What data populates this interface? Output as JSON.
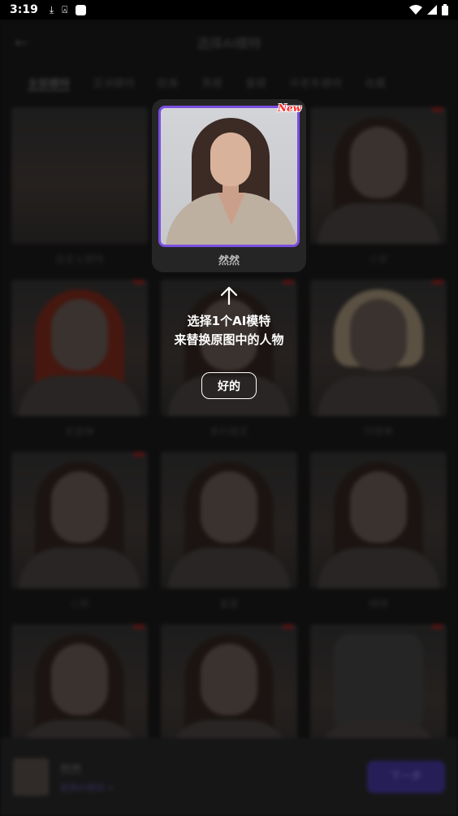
{
  "status_bar": {
    "time": "3:19",
    "icons": [
      "download-icon",
      "a-icon",
      "square-icon",
      "wifi-icon",
      "signal-icon",
      "battery-icon"
    ]
  },
  "header": {
    "title": "选择AI模特"
  },
  "tabs": [
    {
      "label": "全部模特",
      "active": true
    },
    {
      "label": "亚洲模特",
      "active": false
    },
    {
      "label": "欧美",
      "active": false
    },
    {
      "label": "男模",
      "active": false
    },
    {
      "label": "童模",
      "active": false
    },
    {
      "label": "中老年模特",
      "active": false
    },
    {
      "label": "收藏",
      "active": false
    }
  ],
  "models": [
    {
      "name": "自定义模特",
      "style": "custom",
      "new": false
    },
    {
      "name": "然然",
      "style": "highlight",
      "new": true
    },
    {
      "name": "小安",
      "style": "default",
      "new": true
    },
    {
      "name": "凯瑟琳",
      "style": "red",
      "new": true
    },
    {
      "name": "奥利维亚",
      "style": "default",
      "new": true
    },
    {
      "name": "阿德琳",
      "style": "blonde",
      "new": true
    },
    {
      "name": "小雨",
      "style": "default",
      "new": true
    },
    {
      "name": "嘉嘉",
      "style": "default",
      "new": false
    },
    {
      "name": "晴晴",
      "style": "default",
      "new": false
    },
    {
      "name": "",
      "style": "default",
      "new": true
    },
    {
      "name": "",
      "style": "default",
      "new": true
    },
    {
      "name": "",
      "style": "hoodie",
      "new": true
    }
  ],
  "highlight_card": {
    "name": "然然",
    "badge": "New"
  },
  "tooltip": {
    "line1": "选择1个AI模特",
    "line2": "来替换原图中的人物",
    "button": "好的"
  },
  "bottom_bar": {
    "selected_name": "然然",
    "sub_label": "更换AI模特 >",
    "button": "下一步"
  },
  "colors": {
    "accent": "#7a4ee0",
    "new_badge": "#ff2a2a",
    "background": "#111111"
  }
}
